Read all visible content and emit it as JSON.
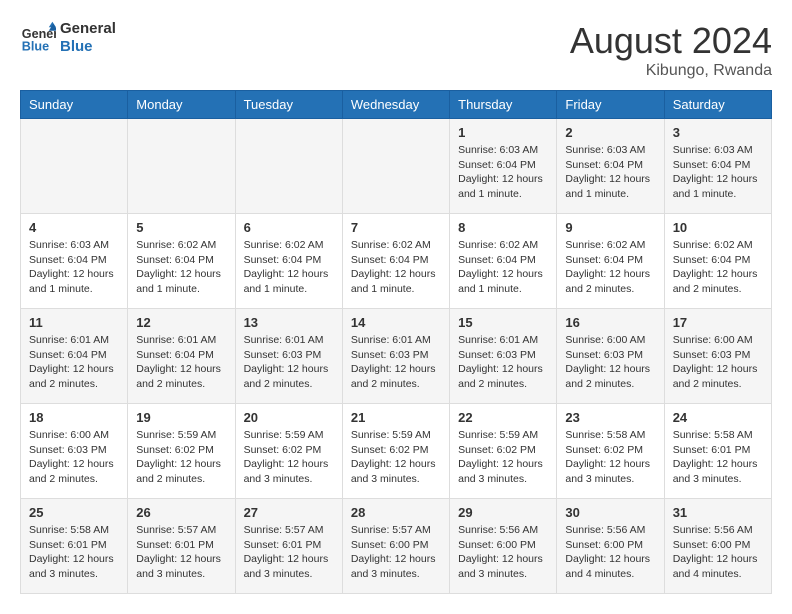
{
  "header": {
    "logo_general": "General",
    "logo_blue": "Blue",
    "title": "August 2024",
    "subtitle": "Kibungo, Rwanda"
  },
  "weekdays": [
    "Sunday",
    "Monday",
    "Tuesday",
    "Wednesday",
    "Thursday",
    "Friday",
    "Saturday"
  ],
  "weeks": [
    [
      {
        "day": "",
        "info": ""
      },
      {
        "day": "",
        "info": ""
      },
      {
        "day": "",
        "info": ""
      },
      {
        "day": "",
        "info": ""
      },
      {
        "day": "1",
        "info": "Sunrise: 6:03 AM\nSunset: 6:04 PM\nDaylight: 12 hours\nand 1 minute."
      },
      {
        "day": "2",
        "info": "Sunrise: 6:03 AM\nSunset: 6:04 PM\nDaylight: 12 hours\nand 1 minute."
      },
      {
        "day": "3",
        "info": "Sunrise: 6:03 AM\nSunset: 6:04 PM\nDaylight: 12 hours\nand 1 minute."
      }
    ],
    [
      {
        "day": "4",
        "info": "Sunrise: 6:03 AM\nSunset: 6:04 PM\nDaylight: 12 hours\nand 1 minute."
      },
      {
        "day": "5",
        "info": "Sunrise: 6:02 AM\nSunset: 6:04 PM\nDaylight: 12 hours\nand 1 minute."
      },
      {
        "day": "6",
        "info": "Sunrise: 6:02 AM\nSunset: 6:04 PM\nDaylight: 12 hours\nand 1 minute."
      },
      {
        "day": "7",
        "info": "Sunrise: 6:02 AM\nSunset: 6:04 PM\nDaylight: 12 hours\nand 1 minute."
      },
      {
        "day": "8",
        "info": "Sunrise: 6:02 AM\nSunset: 6:04 PM\nDaylight: 12 hours\nand 1 minute."
      },
      {
        "day": "9",
        "info": "Sunrise: 6:02 AM\nSunset: 6:04 PM\nDaylight: 12 hours\nand 2 minutes."
      },
      {
        "day": "10",
        "info": "Sunrise: 6:02 AM\nSunset: 6:04 PM\nDaylight: 12 hours\nand 2 minutes."
      }
    ],
    [
      {
        "day": "11",
        "info": "Sunrise: 6:01 AM\nSunset: 6:04 PM\nDaylight: 12 hours\nand 2 minutes."
      },
      {
        "day": "12",
        "info": "Sunrise: 6:01 AM\nSunset: 6:04 PM\nDaylight: 12 hours\nand 2 minutes."
      },
      {
        "day": "13",
        "info": "Sunrise: 6:01 AM\nSunset: 6:03 PM\nDaylight: 12 hours\nand 2 minutes."
      },
      {
        "day": "14",
        "info": "Sunrise: 6:01 AM\nSunset: 6:03 PM\nDaylight: 12 hours\nand 2 minutes."
      },
      {
        "day": "15",
        "info": "Sunrise: 6:01 AM\nSunset: 6:03 PM\nDaylight: 12 hours\nand 2 minutes."
      },
      {
        "day": "16",
        "info": "Sunrise: 6:00 AM\nSunset: 6:03 PM\nDaylight: 12 hours\nand 2 minutes."
      },
      {
        "day": "17",
        "info": "Sunrise: 6:00 AM\nSunset: 6:03 PM\nDaylight: 12 hours\nand 2 minutes."
      }
    ],
    [
      {
        "day": "18",
        "info": "Sunrise: 6:00 AM\nSunset: 6:03 PM\nDaylight: 12 hours\nand 2 minutes."
      },
      {
        "day": "19",
        "info": "Sunrise: 5:59 AM\nSunset: 6:02 PM\nDaylight: 12 hours\nand 2 minutes."
      },
      {
        "day": "20",
        "info": "Sunrise: 5:59 AM\nSunset: 6:02 PM\nDaylight: 12 hours\nand 3 minutes."
      },
      {
        "day": "21",
        "info": "Sunrise: 5:59 AM\nSunset: 6:02 PM\nDaylight: 12 hours\nand 3 minutes."
      },
      {
        "day": "22",
        "info": "Sunrise: 5:59 AM\nSunset: 6:02 PM\nDaylight: 12 hours\nand 3 minutes."
      },
      {
        "day": "23",
        "info": "Sunrise: 5:58 AM\nSunset: 6:02 PM\nDaylight: 12 hours\nand 3 minutes."
      },
      {
        "day": "24",
        "info": "Sunrise: 5:58 AM\nSunset: 6:01 PM\nDaylight: 12 hours\nand 3 minutes."
      }
    ],
    [
      {
        "day": "25",
        "info": "Sunrise: 5:58 AM\nSunset: 6:01 PM\nDaylight: 12 hours\nand 3 minutes."
      },
      {
        "day": "26",
        "info": "Sunrise: 5:57 AM\nSunset: 6:01 PM\nDaylight: 12 hours\nand 3 minutes."
      },
      {
        "day": "27",
        "info": "Sunrise: 5:57 AM\nSunset: 6:01 PM\nDaylight: 12 hours\nand 3 minutes."
      },
      {
        "day": "28",
        "info": "Sunrise: 5:57 AM\nSunset: 6:00 PM\nDaylight: 12 hours\nand 3 minutes."
      },
      {
        "day": "29",
        "info": "Sunrise: 5:56 AM\nSunset: 6:00 PM\nDaylight: 12 hours\nand 3 minutes."
      },
      {
        "day": "30",
        "info": "Sunrise: 5:56 AM\nSunset: 6:00 PM\nDaylight: 12 hours\nand 4 minutes."
      },
      {
        "day": "31",
        "info": "Sunrise: 5:56 AM\nSunset: 6:00 PM\nDaylight: 12 hours\nand 4 minutes."
      }
    ]
  ]
}
